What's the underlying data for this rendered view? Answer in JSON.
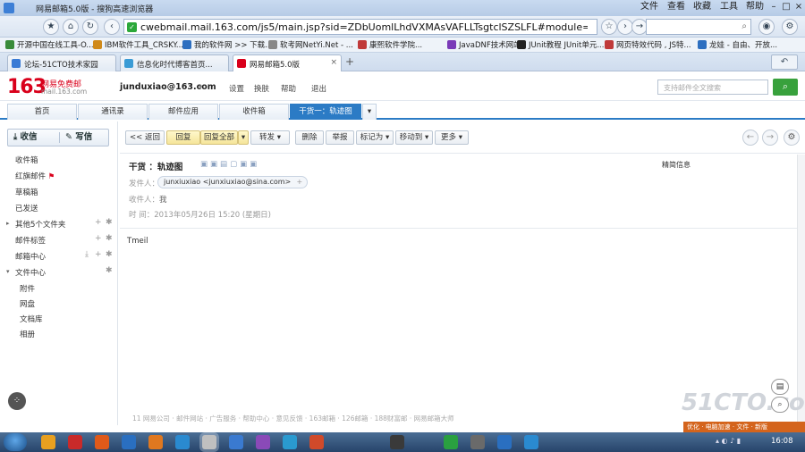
{
  "window": {
    "title": "网易邮箱5.0版 - 搜狗高速浏览器",
    "controls": [
      "文件",
      "查看",
      "收藏",
      "工具",
      "帮助"
    ]
  },
  "browser": {
    "url": "cwebmail.mail.163.com/js5/main.jsp?sid=ZDbUomlLhdVXMAsVAFLLTsgtclSZSLFL#module=read.ReadMc",
    "search_placeholder": ""
  },
  "bookmarks": [
    {
      "label": "开源中国在线工具-O...",
      "color": "#3a8c3a"
    },
    {
      "label": "IBM软件工具_CRSKY...",
      "color": "#d08a1a"
    },
    {
      "label": "我的软件网 >> 下载...",
      "color": "#2d6fc0"
    },
    {
      "label": "软考网NetYi.Net - ...",
      "color": "#888888"
    },
    {
      "label": "康熙软件学院...",
      "color": "#c03a3a"
    },
    {
      "label": "JavaDNF技术网站",
      "color": "#7a3ab8"
    },
    {
      "label": "JUnit教程 JUnit单元...",
      "color": "#222222"
    },
    {
      "label": "网页特效代码 , JS特...",
      "color": "#c03a3a"
    },
    {
      "label": "龙娃 - 自由、开放...",
      "color": "#2d6fc0"
    }
  ],
  "browser_tabs": [
    {
      "label": "论坛-51CTO技术家园",
      "active": false,
      "color": "#3a7bd5"
    },
    {
      "label": "信息化时代博客首页...",
      "active": false,
      "color": "#3a9bd5"
    },
    {
      "label": "网易邮箱5.0版",
      "active": true,
      "color": "#d9001b"
    }
  ],
  "mail": {
    "logo": "163",
    "logo_sub1": "网易免费邮",
    "logo_sub2": "mail.163.com",
    "user": "junduxiao@163.com",
    "header_links": [
      "设置",
      "换肤",
      "帮助",
      "退出"
    ],
    "search_placeholder": "支持邮件全文搜索",
    "tabs": [
      {
        "label": "首页",
        "active": false
      },
      {
        "label": "通讯录",
        "active": false
      },
      {
        "label": "邮件应用",
        "active": false
      },
      {
        "label": "收件箱",
        "active": false
      },
      {
        "label": "干货一：轨迹图",
        "active": true
      }
    ]
  },
  "sidebar": {
    "receive_label": "收信",
    "compose_label": "写信",
    "folders": [
      {
        "label": "收件箱"
      },
      {
        "label": "红旗邮件"
      },
      {
        "label": "草稿箱"
      },
      {
        "label": "已发送"
      },
      {
        "label": "其他5个文件夹"
      },
      {
        "label": "邮件标签"
      },
      {
        "label": "邮箱中心"
      },
      {
        "label": "文件中心"
      }
    ],
    "subfolders": [
      {
        "label": "附件"
      },
      {
        "label": "网盘"
      },
      {
        "label": "文档库"
      },
      {
        "label": "相册"
      }
    ]
  },
  "actions": {
    "back": "<< 返回",
    "reply": "回复",
    "reply_all": "回复全部",
    "forward": "转发",
    "delete": "删除",
    "report": "举报",
    "mark": "标记为",
    "move": "移动到",
    "more": "更多"
  },
  "message": {
    "subject_label": "干货",
    "subject": "：轨迹图",
    "sender_label": "发件人：",
    "sender": "junxiuxiao <junxiuxiao@sina.com>",
    "recipient_label": "收件人：",
    "recipient": "我",
    "time_label": "时  间：",
    "time": "2013年05月26日 15:20 (星期日)",
    "body": "Tmeil",
    "quick_view": "精简信息"
  },
  "footer_text": "11 网易公司 · 邮件网站 · 广告服务 · 帮助中心 · 意见反馈 · 163邮箱 · 126邮箱 · 188财富邮 · 网易邮箱大师",
  "watermark": "51CTO.com",
  "orange_bar": "优化 · 电脑加速 · 文件 · 新版",
  "taskbar": {
    "clock": "16:08",
    "icons": [
      {
        "color": "#e8a020"
      },
      {
        "color": "#c92a2a"
      },
      {
        "color": "#e05a1a"
      },
      {
        "color": "#2a6fc0"
      },
      {
        "color": "#e07820"
      },
      {
        "color": "#2a8ad0"
      },
      {
        "color": "#c0c0c0",
        "active": true
      },
      {
        "color": "#3a7ad0"
      },
      {
        "color": "#8a4ab8"
      },
      {
        "color": "#2a9ad0"
      },
      {
        "color": "#d04a2a"
      },
      {
        "color": "#3a3a3a"
      },
      {
        "color": "#2aa040"
      },
      {
        "color": "#6a6a6a"
      },
      {
        "color": "#2a6fc0"
      },
      {
        "color": "#2a8ad0"
      }
    ]
  }
}
